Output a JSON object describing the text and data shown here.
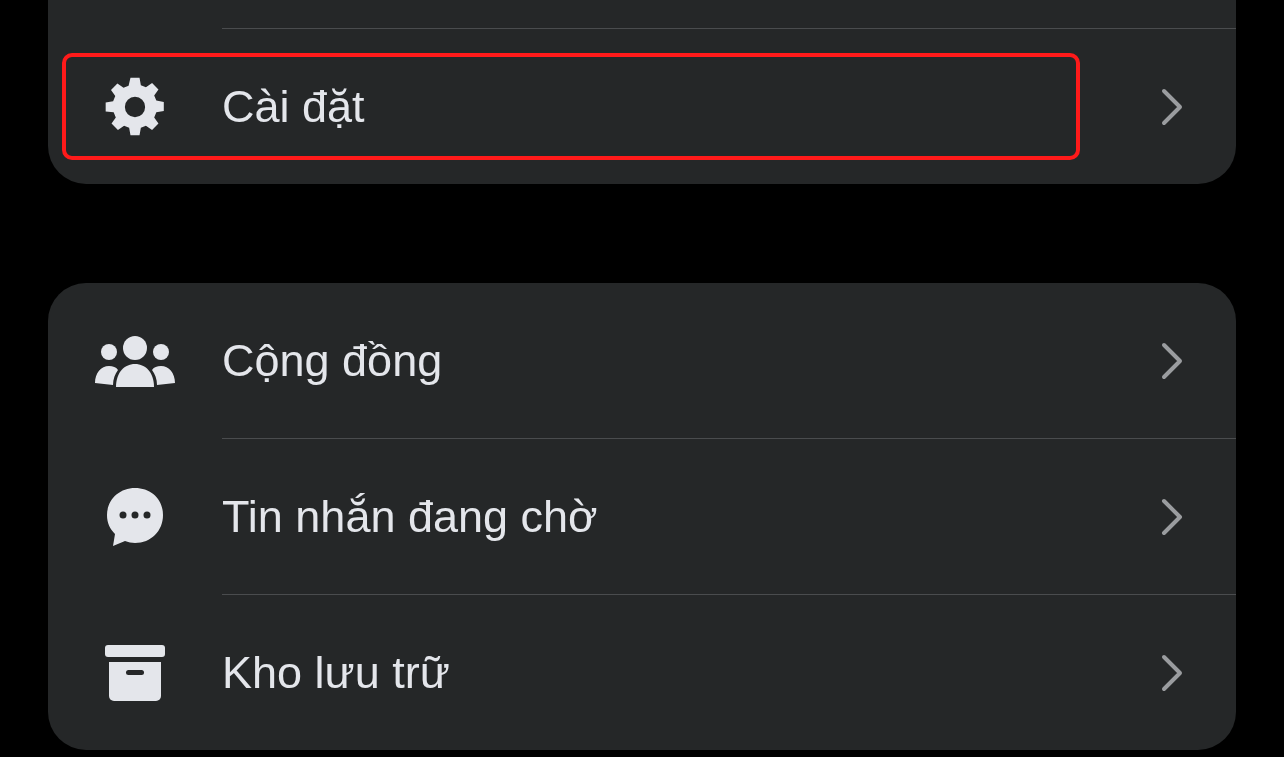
{
  "groups": [
    {
      "items": [
        {
          "kind": "settings",
          "label": "Cài đặt",
          "highlighted": true
        }
      ]
    },
    {
      "items": [
        {
          "kind": "community",
          "label": "Cộng đồng",
          "highlighted": false
        },
        {
          "kind": "pending",
          "label": "Tin nhắn đang chờ",
          "highlighted": false
        },
        {
          "kind": "archive",
          "label": "Kho lưu trữ",
          "highlighted": false
        }
      ]
    }
  ]
}
